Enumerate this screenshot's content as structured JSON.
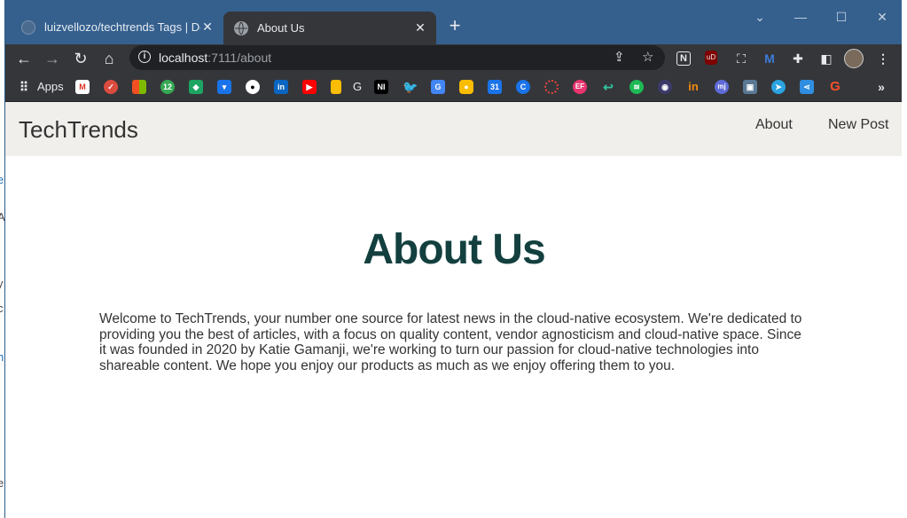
{
  "browser": {
    "tabs": [
      {
        "title": "luizvellozo/techtrends Tags | Doc",
        "close": "✕",
        "active": false
      },
      {
        "title": "About Us",
        "close": "✕",
        "active": true
      }
    ],
    "new_tab": "+",
    "url_host": "localhost",
    "url_path": ":7111/about",
    "bookmarks_apps_label": "Apps",
    "bookmark_g_label": "G"
  },
  "site": {
    "brand": "TechTrends",
    "nav": [
      {
        "label": "About"
      },
      {
        "label": "New Post"
      }
    ]
  },
  "content": {
    "heading": "About Us",
    "paragraph": "Welcome to TechTrends, your number one source for latest news in the cloud-native ecosystem. We're dedicated to providing you the best of articles, with a focus on quality content, vendor agnosticism and cloud-native space. Since it was founded in 2020 by Katie Gamanji, we're working to turn our passion for cloud-native technologies into shareable content. We hope you enjoy our products as much as we enjoy offering them to you."
  },
  "colors": {
    "titlebar": "#35608e",
    "toolbar": "#35363a",
    "navbar": "#f0efeb",
    "heading": "#13403f"
  }
}
